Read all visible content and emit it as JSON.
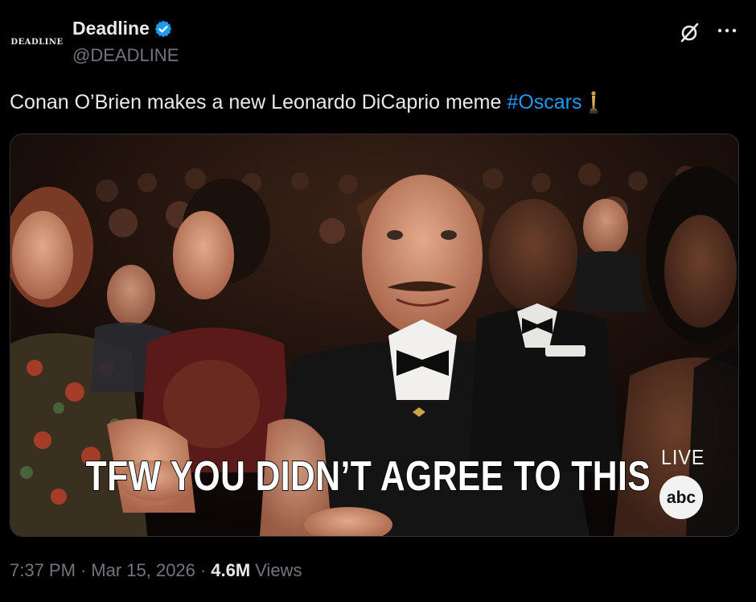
{
  "author": {
    "avatar_text": "DEADLINE",
    "display_name": "Deadline",
    "handle": "@DEADLINE",
    "verified_badge": "verified-badge-icon"
  },
  "tweet": {
    "text": "Conan O’Brien makes a new Leonardo DiCaprio meme",
    "hashtag": "#Oscars",
    "emoji": "oscar-trophy-icon"
  },
  "media": {
    "caption": "TFW YOU DIDN’T AGREE TO THIS",
    "live_label": "LIVE",
    "network_logo_text": "abc"
  },
  "meta": {
    "time": "7:37 PM",
    "date": "Mar 15, 2026",
    "views_count": "4.6M",
    "views_label": "Views"
  },
  "actions": {
    "grok_icon": "grok-icon",
    "more_icon": "more-icon"
  },
  "colors": {
    "background": "#000000",
    "text": "#e7e9ea",
    "muted": "#71767b",
    "accent": "#1d9bf0"
  }
}
